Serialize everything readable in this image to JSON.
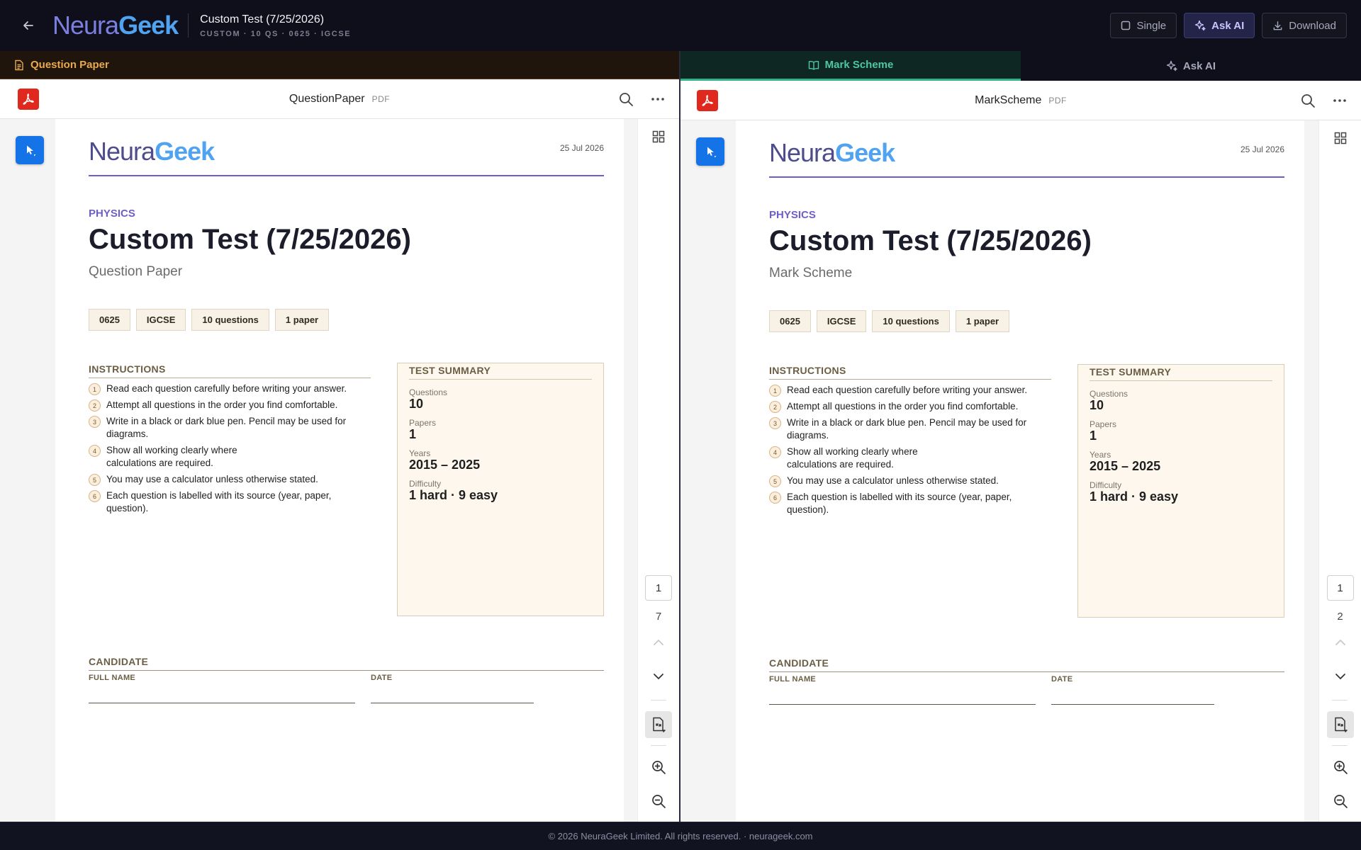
{
  "header": {
    "brand_part1": "Neura",
    "brand_part2": "Geek",
    "title": "Custom Test (7/25/2026)",
    "subtitle": "CUSTOM · 10 QS · 0625 · IGCSE",
    "buttons": {
      "single": "Single",
      "ask_ai": "Ask AI",
      "download": "Download"
    }
  },
  "left_pane": {
    "tab_label": "Question Paper"
  },
  "right_pane": {
    "tabs": [
      {
        "label": "Mark Scheme",
        "active": true
      },
      {
        "label": "Ask AI",
        "active": false
      }
    ]
  },
  "viewers": [
    {
      "file_name": "QuestionPaper",
      "file_type": "PDF",
      "current_page": "1",
      "total_pages": "7",
      "document": {
        "brand_part1": "Neura",
        "brand_part2": "Geek",
        "date": "25 Jul 2026",
        "subject": "PHYSICS",
        "title": "Custom Test (7/25/2026)",
        "kind": "Question Paper",
        "chips": [
          "0625",
          "IGCSE",
          "10 questions",
          "1 paper"
        ],
        "instructions_heading": "INSTRUCTIONS",
        "instructions": [
          {
            "n": "1",
            "text": "Read each question carefully before writing your answer."
          },
          {
            "n": "2",
            "text": "Attempt all questions in the order you find comfortable."
          },
          {
            "n": "3",
            "text": "Write in a black or dark blue pen. Pencil may be used for diagrams."
          },
          {
            "n": "4",
            "text": "Show all working clearly where calculations are required."
          },
          {
            "n": "5",
            "text": "You may use a calculator unless otherwise stated."
          },
          {
            "n": "6",
            "text": "Each question is labelled with its source (year, paper, question)."
          }
        ],
        "summary_heading": "TEST SUMMARY",
        "summary": [
          {
            "label": "Questions",
            "value": "10"
          },
          {
            "label": "Papers",
            "value": "1"
          },
          {
            "label": "Years",
            "value": "2015 – 2025"
          },
          {
            "label": "Difficulty",
            "value": "1 hard · 9 easy"
          }
        ],
        "candidate_heading": "CANDIDATE",
        "field_full_name": "FULL NAME",
        "field_date": "DATE"
      }
    },
    {
      "file_name": "MarkScheme",
      "file_type": "PDF",
      "current_page": "1",
      "total_pages": "2",
      "document": {
        "brand_part1": "Neura",
        "brand_part2": "Geek",
        "date": "25 Jul 2026",
        "subject": "PHYSICS",
        "title": "Custom Test (7/25/2026)",
        "kind": "Mark Scheme",
        "chips": [
          "0625",
          "IGCSE",
          "10 questions",
          "1 paper"
        ],
        "instructions_heading": "INSTRUCTIONS",
        "instructions": [
          {
            "n": "1",
            "text": "Read each question carefully before writing your answer."
          },
          {
            "n": "2",
            "text": "Attempt all questions in the order you find comfortable."
          },
          {
            "n": "3",
            "text": "Write in a black or dark blue pen. Pencil may be used for diagrams."
          },
          {
            "n": "4",
            "text": "Show all working clearly where calculations are required."
          },
          {
            "n": "5",
            "text": "You may use a calculator unless otherwise stated."
          },
          {
            "n": "6",
            "text": "Each question is labelled with its source (year, paper, question)."
          }
        ],
        "summary_heading": "TEST SUMMARY",
        "summary": [
          {
            "label": "Questions",
            "value": "10"
          },
          {
            "label": "Papers",
            "value": "1"
          },
          {
            "label": "Years",
            "value": "2015 – 2025"
          },
          {
            "label": "Difficulty",
            "value": "1 hard · 9 easy"
          }
        ],
        "candidate_heading": "CANDIDATE",
        "field_full_name": "FULL NAME",
        "field_date": "DATE"
      }
    }
  ],
  "footer": {
    "text": "© 2026 NeuraGeek Limited. All rights reserved. · neurageek.com"
  },
  "colors": {
    "accent_purple": "#6c5fc7",
    "accent_blue": "#4fa3f0",
    "accent_green": "#2fb48b",
    "accent_orange": "#e8a94f",
    "pdf_red": "#e0281e",
    "select_blue": "#1473e6"
  }
}
